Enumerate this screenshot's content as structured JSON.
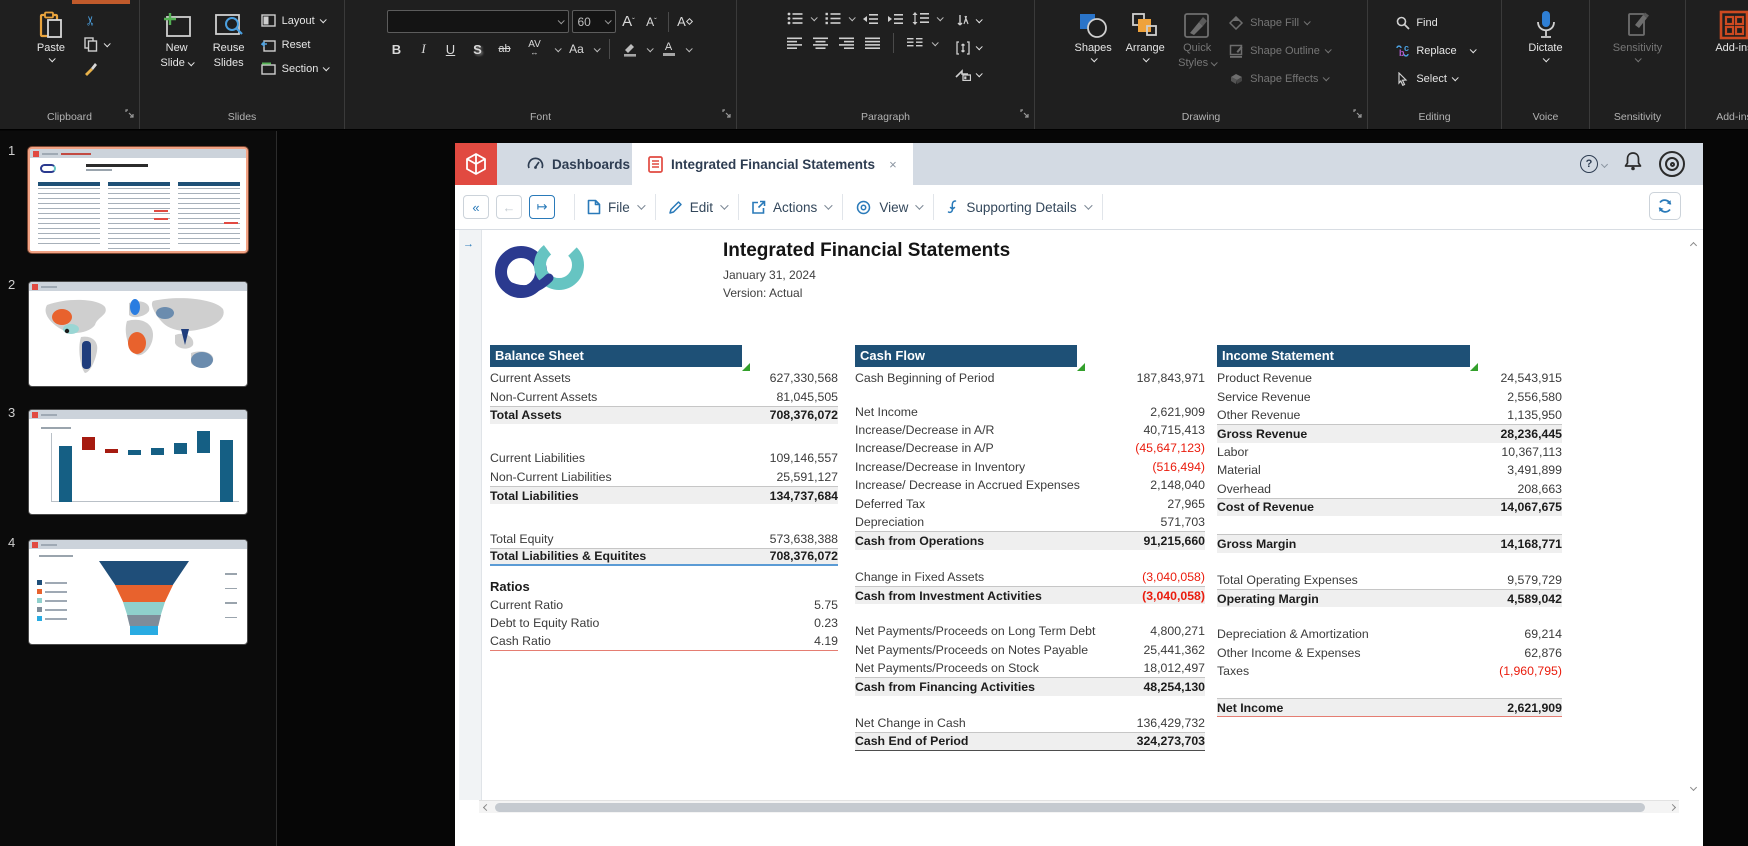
{
  "ribbon": {
    "clipboard": {
      "label": "Clipboard",
      "paste": "Paste"
    },
    "slides": {
      "label": "Slides",
      "new_slide_1": "New",
      "new_slide_2": "Slide",
      "reuse_1": "Reuse",
      "reuse_2": "Slides",
      "layout": "Layout",
      "reset": "Reset",
      "section": "Section"
    },
    "font": {
      "label": "Font",
      "size": "60"
    },
    "paragraph": {
      "label": "Paragraph"
    },
    "drawing": {
      "label": "Drawing",
      "shapes": "Shapes",
      "arrange": "Arrange",
      "quick_1": "Quick",
      "quick_2": "Styles",
      "shape_fill": "Shape Fill",
      "shape_outline": "Shape Outline",
      "shape_effects": "Shape Effects"
    },
    "editing": {
      "label": "Editing",
      "find": "Find",
      "replace": "Replace",
      "select": "Select"
    },
    "voice": {
      "label": "Voice",
      "dictate": "Dictate"
    },
    "sensitivity": {
      "label": "Sensitivity",
      "button": "Sensitivity"
    },
    "addins": {
      "label": "Add-ins",
      "button": "Add-ins"
    }
  },
  "glyphs": {
    "bold": "B",
    "italic": "I",
    "underline": "U",
    "shadow": "S",
    "strike": "ab",
    "spacing": "AV",
    "case": "Aa",
    "fontcolor": "A",
    "grow": "A",
    "shrink": "A",
    "clear": "A",
    "back": "«",
    "prev": "←",
    "next": "↦",
    "close": "×",
    "help": "?",
    "gutter_arrow": "→"
  },
  "thumbnails": [
    {
      "number": "1"
    },
    {
      "number": "2"
    },
    {
      "number": "3"
    },
    {
      "number": "4"
    }
  ],
  "app": {
    "tabs": {
      "dashboards": "Dashboards",
      "document": "Integrated Financial Statements"
    },
    "toolbar": {
      "file": "File",
      "edit": "Edit",
      "actions": "Actions",
      "view": "View",
      "supporting_details": "Supporting Details"
    },
    "doc_header": {
      "title": "Integrated Financial Statements",
      "date": "January 31, 2024",
      "version": "Version: Actual"
    }
  },
  "tables": {
    "balance_sheet": {
      "title": "Balance Sheet",
      "rows": [
        {
          "l": "Current Assets",
          "v": "627,330,568"
        },
        {
          "l": "Non-Current Assets",
          "v": "81,045,505"
        },
        {
          "l": "Total Assets",
          "v": "708,376,072",
          "c": "tot"
        },
        {
          "s": 25
        },
        {
          "l": "Current Liabilities",
          "v": "109,146,557"
        },
        {
          "l": "Non-Current Liabilities",
          "v": "25,591,127"
        },
        {
          "l": "Total Liabilities",
          "v": "134,737,684",
          "c": "tot"
        },
        {
          "s": 25
        },
        {
          "l": "Total Equity",
          "v": "573,638,388"
        },
        {
          "l": "Total Liabilities & Equitites",
          "v": "708,376,072",
          "c": "tot",
          "u": "blue"
        },
        {
          "s": 11
        },
        {
          "l": "Ratios",
          "v": "",
          "c": "sec"
        },
        {
          "l": "Current Ratio",
          "v": "5.75"
        },
        {
          "l": "Debt to Equity Ratio",
          "v": "0.23"
        },
        {
          "l": "Cash Ratio",
          "v": "4.19",
          "u": "red"
        }
      ]
    },
    "cash_flow": {
      "title": "Cash Flow",
      "rows": [
        {
          "l": "Cash Beginning of Period",
          "v": "187,843,971"
        },
        {
          "s": 15
        },
        {
          "l": "Net Income",
          "v": "2,621,909"
        },
        {
          "l": "Increase/Decrease in A/R",
          "v": "40,715,413"
        },
        {
          "l": "Increase/Decrease in A/P",
          "v": "(45,647,123)",
          "n": true
        },
        {
          "l": "Increase/Decrease in Inventory",
          "v": "(516,494)",
          "n": true
        },
        {
          "l": "Increase/ Decrease in Accrued Expenses",
          "v": "2,148,040"
        },
        {
          "l": "Deferred Tax",
          "v": "27,965"
        },
        {
          "l": "Depreciation",
          "v": "571,703"
        },
        {
          "l": "Cash from Operations",
          "v": "91,215,660",
          "c": "tot"
        },
        {
          "s": 18
        },
        {
          "l": "Change in Fixed Assets",
          "v": "(3,040,058)",
          "n": true
        },
        {
          "l": "Cash from Investment Activities",
          "v": "(3,040,058)",
          "c": "tot",
          "n": true
        },
        {
          "s": 18
        },
        {
          "l": "Net Payments/Proceeds on Long Term Debt",
          "v": "4,800,271"
        },
        {
          "l": "Net Payments/Proceeds on Notes Payable",
          "v": "25,441,362"
        },
        {
          "l": "Net Payments/Proceeds on Stock",
          "v": "18,012,497"
        },
        {
          "l": "Cash from Financing Activities",
          "v": "48,254,130",
          "c": "tot"
        },
        {
          "s": 18
        },
        {
          "l": "Net Change in Cash",
          "v": "136,429,732"
        },
        {
          "l": "Cash End of Period",
          "v": "324,273,703",
          "c": "tot",
          "u": "dark"
        }
      ]
    },
    "income_statement": {
      "title": "Income Statement",
      "rows": [
        {
          "l": "Product Revenue",
          "v": "24,543,915"
        },
        {
          "l": "Service Revenue",
          "v": "2,556,580"
        },
        {
          "l": "Other Revenue",
          "v": "1,135,950"
        },
        {
          "l": "Gross Revenue",
          "v": "28,236,445",
          "c": "tot"
        },
        {
          "l": "Labor",
          "v": "10,367,113"
        },
        {
          "l": "Material",
          "v": "3,491,899"
        },
        {
          "l": "Overhead",
          "v": "208,663"
        },
        {
          "l": "Cost of Revenue",
          "v": "14,067,675",
          "c": "tot"
        },
        {
          "s": 18
        },
        {
          "l": "Gross Margin",
          "v": "14,168,771",
          "c": "tot"
        },
        {
          "s": 18
        },
        {
          "l": "Total Operating Expenses",
          "v": "9,579,729"
        },
        {
          "l": "Operating Margin",
          "v": "4,589,042",
          "c": "tot"
        },
        {
          "s": 18
        },
        {
          "l": "Depreciation & Amortization",
          "v": "69,214"
        },
        {
          "l": "Other Income & Expenses",
          "v": "62,876"
        },
        {
          "l": "Taxes",
          "v": "(1,960,795)",
          "n": true
        },
        {
          "s": 18
        },
        {
          "l": "Net Income",
          "v": "2,621,909",
          "c": "tot",
          "u": "red"
        }
      ]
    }
  },
  "colors": {
    "table_header": "#1e5076",
    "negative": "#ea1c0d",
    "app_red": "#e14a41",
    "toolbar_blue": "#2a7ab9",
    "tabstrip": "#d3dae3",
    "ribbon_bg": "#1f1f1f",
    "accent_orange": "#efa23c",
    "accent_green": "#54b054",
    "addins_red": "#ce4a21"
  }
}
